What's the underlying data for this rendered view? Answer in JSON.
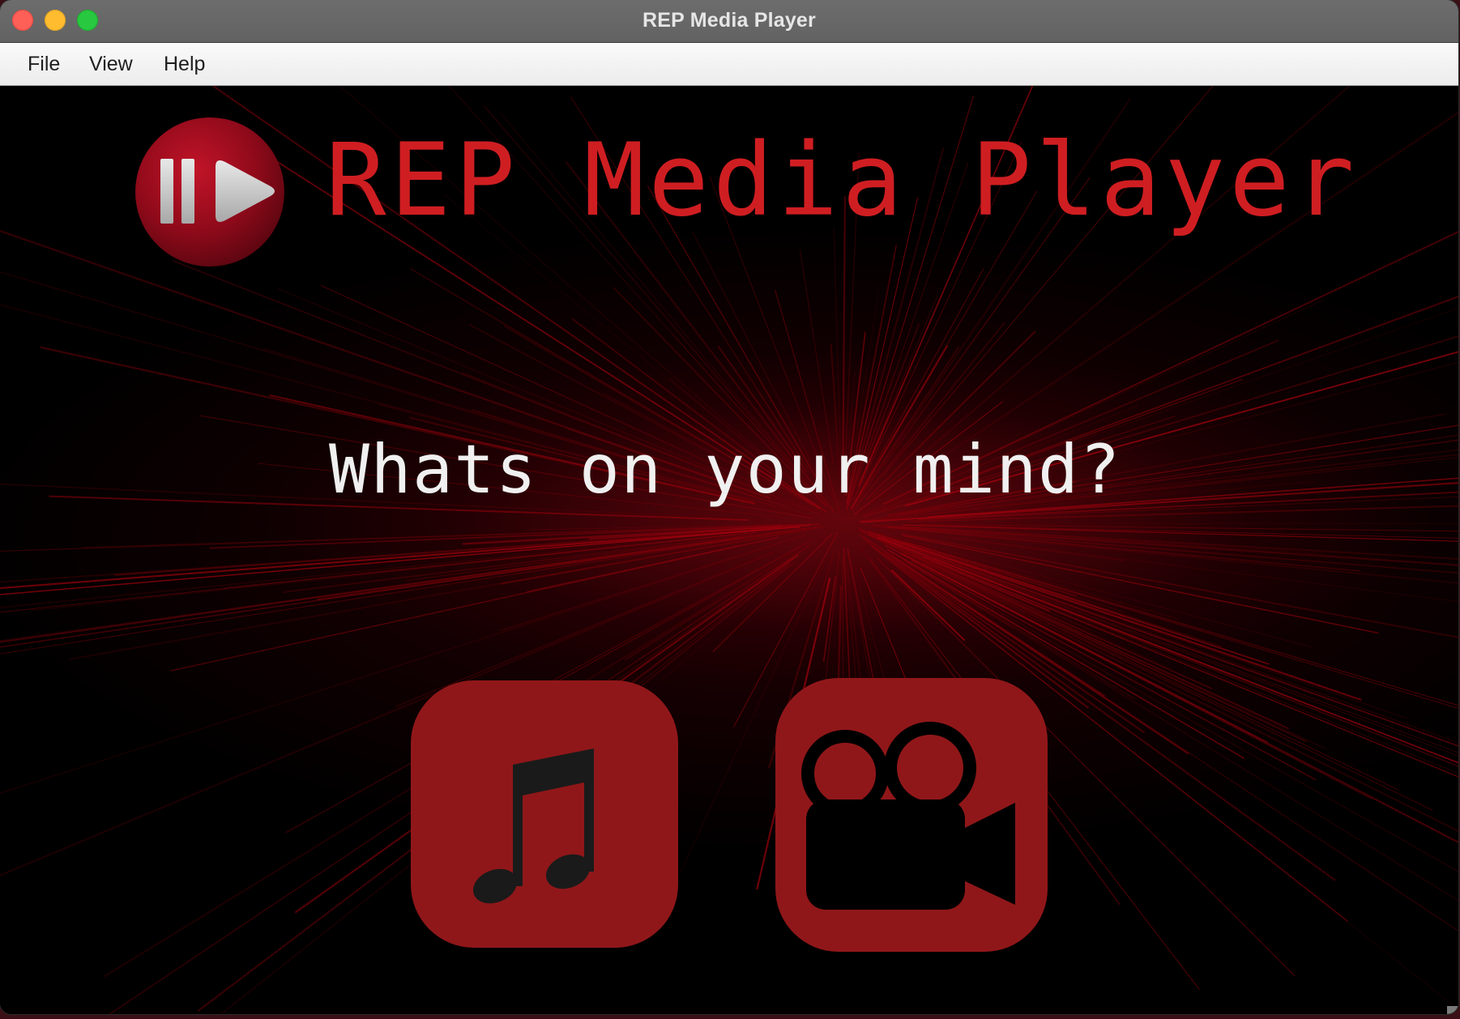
{
  "window": {
    "title": "REP Media Player",
    "controls": [
      "close-icon",
      "minimize-icon",
      "maximize-icon"
    ]
  },
  "menubar": {
    "items": [
      {
        "label": "File"
      },
      {
        "label": "View"
      },
      {
        "label": "Help"
      }
    ]
  },
  "main": {
    "logo_icon": "pause-play-icon",
    "heading": "REP Media Player",
    "prompt": "Whats on your mind?",
    "buttons": [
      {
        "icon": "music-note-icon"
      },
      {
        "icon": "video-camera-icon"
      }
    ]
  },
  "colors": {
    "accent_red": "#cf1e22",
    "button_red": "#901719",
    "background": "#000000",
    "prompt_text": "#f0f0f0"
  }
}
